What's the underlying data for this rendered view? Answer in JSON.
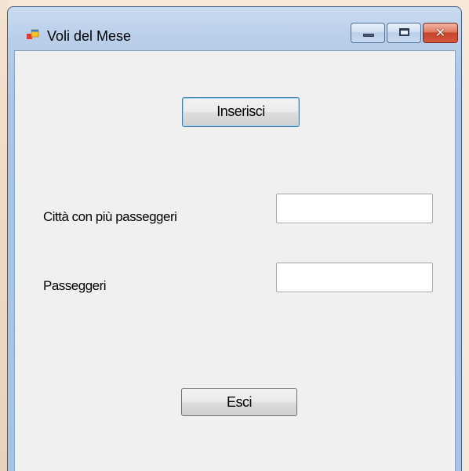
{
  "window": {
    "title": "Voli del Mese",
    "icon": "form-app-icon",
    "controls": {
      "minimize": "minimize-icon",
      "maximize": "maximize-icon",
      "close": "close-icon"
    }
  },
  "form": {
    "insert_button": "Inserisci",
    "city_label": "Città con più passeggeri",
    "city_value": "",
    "passengers_label": "Passeggeri",
    "passengers_value": "",
    "exit_button": "Esci"
  },
  "colors": {
    "frame": "#a9c4e6",
    "client": "#f0f0f0",
    "close_button": "#c8442a",
    "focus_border": "#3c7fb1"
  }
}
